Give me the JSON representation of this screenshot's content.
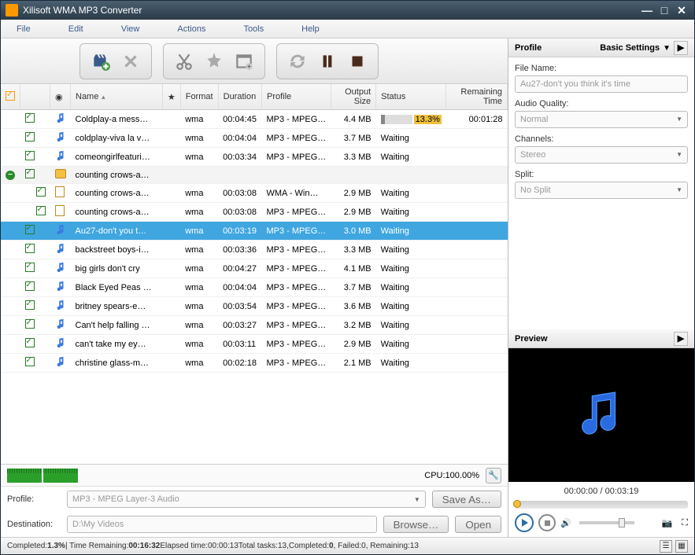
{
  "title": "Xilisoft WMA MP3 Converter",
  "menu": {
    "file": "File",
    "edit": "Edit",
    "view": "View",
    "actions": "Actions",
    "tools": "Tools",
    "help": "Help"
  },
  "cols": {
    "name": "Name",
    "star": "★",
    "format": "Format",
    "duration": "Duration",
    "profile": "Profile",
    "output": "Output Size",
    "status": "Status",
    "remaining": "Remaining Time"
  },
  "rows": [
    {
      "sel": false,
      "type": "note",
      "name": "Coldplay-a mess…",
      "fmt": "wma",
      "dur": "00:04:45",
      "prof": "MP3 - MPEG…",
      "out": "4.4 MB",
      "status": "13.3%",
      "progress": 13.3,
      "rem": "00:01:28",
      "indent": 0
    },
    {
      "sel": false,
      "type": "note",
      "name": "coldplay-viva la v…",
      "fmt": "wma",
      "dur": "00:04:04",
      "prof": "MP3 - MPEG…",
      "out": "3.7 MB",
      "status": "Waiting",
      "rem": "",
      "indent": 0
    },
    {
      "sel": false,
      "type": "note",
      "name": "comeongirlfeaturi…",
      "fmt": "wma",
      "dur": "00:03:34",
      "prof": "MP3 - MPEG…",
      "out": "3.3 MB",
      "status": "Waiting",
      "rem": "",
      "indent": 0
    },
    {
      "sel": false,
      "type": "folder",
      "name": "counting crows-a…",
      "fmt": "",
      "dur": "",
      "prof": "",
      "out": "",
      "status": "",
      "rem": "",
      "indent": 0,
      "expand": true
    },
    {
      "sel": false,
      "type": "doc",
      "name": "counting crows-a…",
      "fmt": "wma",
      "dur": "00:03:08",
      "prof": "WMA - Win…",
      "out": "2.9 MB",
      "status": "Waiting",
      "rem": "",
      "indent": 1
    },
    {
      "sel": false,
      "type": "doc",
      "name": "counting crows-a…",
      "fmt": "wma",
      "dur": "00:03:08",
      "prof": "MP3 - MPEG…",
      "out": "2.9 MB",
      "status": "Waiting",
      "rem": "",
      "indent": 1
    },
    {
      "sel": true,
      "type": "note",
      "name": "Au27-don't you t…",
      "fmt": "wma",
      "dur": "00:03:19",
      "prof": "MP3 - MPEG…",
      "out": "3.0 MB",
      "status": "Waiting",
      "rem": "",
      "indent": 0
    },
    {
      "sel": false,
      "type": "note",
      "name": "backstreet boys-i…",
      "fmt": "wma",
      "dur": "00:03:36",
      "prof": "MP3 - MPEG…",
      "out": "3.3 MB",
      "status": "Waiting",
      "rem": "",
      "indent": 0
    },
    {
      "sel": false,
      "type": "note",
      "name": "big girls don't cry",
      "fmt": "wma",
      "dur": "00:04:27",
      "prof": "MP3 - MPEG…",
      "out": "4.1 MB",
      "status": "Waiting",
      "rem": "",
      "indent": 0
    },
    {
      "sel": false,
      "type": "note",
      "name": "Black Eyed Peas …",
      "fmt": "wma",
      "dur": "00:04:04",
      "prof": "MP3 - MPEG…",
      "out": "3.7 MB",
      "status": "Waiting",
      "rem": "",
      "indent": 0
    },
    {
      "sel": false,
      "type": "note",
      "name": "britney spears-e…",
      "fmt": "wma",
      "dur": "00:03:54",
      "prof": "MP3 - MPEG…",
      "out": "3.6 MB",
      "status": "Waiting",
      "rem": "",
      "indent": 0
    },
    {
      "sel": false,
      "type": "note",
      "name": "Can't help falling …",
      "fmt": "wma",
      "dur": "00:03:27",
      "prof": "MP3 - MPEG…",
      "out": "3.2 MB",
      "status": "Waiting",
      "rem": "",
      "indent": 0
    },
    {
      "sel": false,
      "type": "note",
      "name": "can't take my ey…",
      "fmt": "wma",
      "dur": "00:03:11",
      "prof": "MP3 - MPEG…",
      "out": "2.9 MB",
      "status": "Waiting",
      "rem": "",
      "indent": 0
    },
    {
      "sel": false,
      "type": "note",
      "name": "christine glass-m…",
      "fmt": "wma",
      "dur": "00:02:18",
      "prof": "MP3 - MPEG…",
      "out": "2.1 MB",
      "status": "Waiting",
      "rem": "",
      "indent": 0
    }
  ],
  "profile_panel": {
    "title": "Profile",
    "basic": "Basic Settings",
    "fname_lbl": "File Name:",
    "fname": "Au27-don't you think it's time",
    "aq_lbl": "Audio Quality:",
    "aq": "Normal",
    "ch_lbl": "Channels:",
    "ch": "Stereo",
    "sp_lbl": "Split:",
    "sp": "No Split"
  },
  "preview": {
    "title": "Preview",
    "time": "00:00:00 / 00:03:19"
  },
  "cpu": "CPU:100.00%",
  "profile_row": {
    "lbl": "Profile:",
    "val": "MP3 - MPEG Layer-3 Audio",
    "save": "Save As…"
  },
  "dest_row": {
    "lbl": "Destination:",
    "val": "D:\\My Videos",
    "browse": "Browse…",
    "open": "Open"
  },
  "status": {
    "completed_lbl": "Completed: ",
    "completed": "1.3%",
    "time_lbl": " | Time Remaining: ",
    "time": "00:16:32",
    "elapsed_lbl": " Elapsed time: ",
    "elapsed": "00:00:13",
    "tasks_lbl": " Total tasks: ",
    "tasks": "13",
    "comp2_lbl": " ,Completed: ",
    "comp2": "0",
    "fail_lbl": ", Failed: ",
    "fail": "0",
    "rem_lbl": ", Remaining: ",
    "rem": "13"
  }
}
